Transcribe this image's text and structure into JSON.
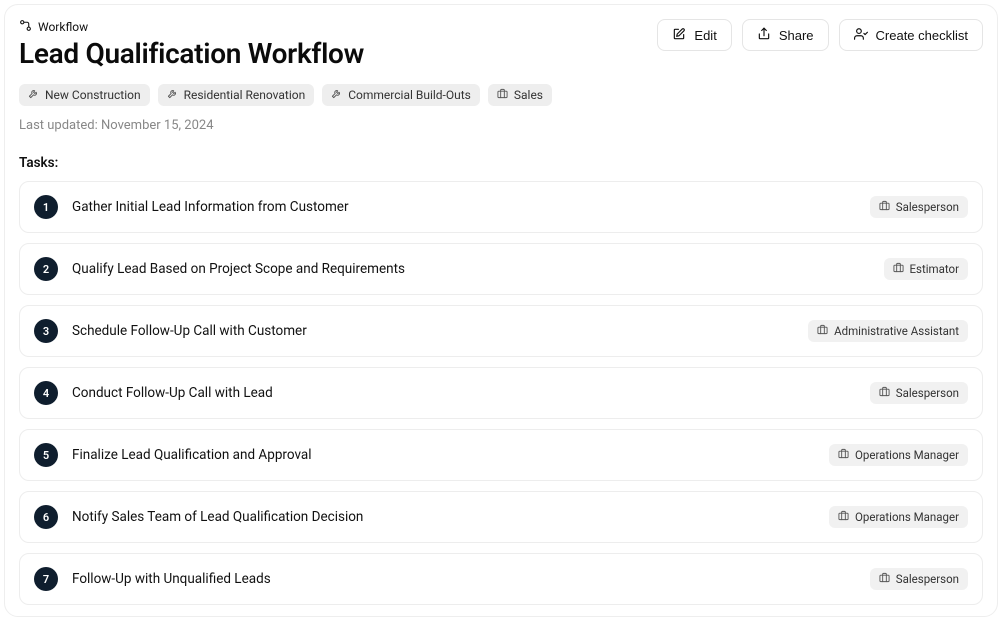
{
  "breadcrumb": {
    "label": "Workflow"
  },
  "title": "Lead Qualification Workflow",
  "actions": {
    "edit": "Edit",
    "share": "Share",
    "create_checklist": "Create checklist"
  },
  "tags": [
    {
      "type": "wrench",
      "label": "New Construction"
    },
    {
      "type": "wrench",
      "label": "Residential Renovation"
    },
    {
      "type": "wrench",
      "label": "Commercial Build-Outs"
    },
    {
      "type": "briefcase",
      "label": "Sales"
    }
  ],
  "updated_prefix": "Last updated: ",
  "updated_date": "November 15, 2024",
  "tasks_label": "Tasks:",
  "tasks": [
    {
      "num": "1",
      "title": "Gather Initial Lead Information from Customer",
      "role": "Salesperson"
    },
    {
      "num": "2",
      "title": "Qualify Lead Based on Project Scope and Requirements",
      "role": "Estimator"
    },
    {
      "num": "3",
      "title": "Schedule Follow-Up Call with Customer",
      "role": "Administrative Assistant"
    },
    {
      "num": "4",
      "title": "Conduct Follow-Up Call with Lead",
      "role": "Salesperson"
    },
    {
      "num": "5",
      "title": "Finalize Lead Qualification and Approval",
      "role": "Operations Manager"
    },
    {
      "num": "6",
      "title": "Notify Sales Team of Lead Qualification Decision",
      "role": "Operations Manager"
    },
    {
      "num": "7",
      "title": "Follow-Up with Unqualified Leads",
      "role": "Salesperson"
    }
  ]
}
